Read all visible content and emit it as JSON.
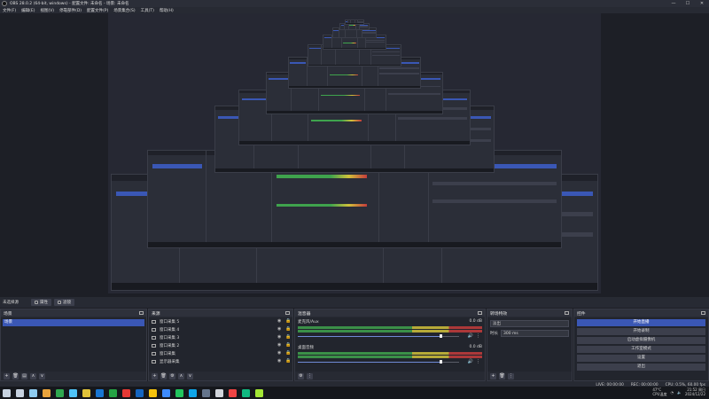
{
  "window": {
    "title": "OBS 28.0.2 (64-bit, windows) - 配置文件: 未命名 - 场景: 未命名",
    "min": "—",
    "max": "☐",
    "close": "✕"
  },
  "menu": [
    "文件(F)",
    "编辑(E)",
    "视图(V)",
    "停靠部件(D)",
    "配置文件(P)",
    "场景集合(S)",
    "工具(T)",
    "帮助(H)"
  ],
  "modebar": {
    "label": "未选择源",
    "properties": "属性",
    "filters": "滤镜"
  },
  "docks": {
    "scenes": {
      "title": "场景",
      "items": [
        "场景"
      ]
    },
    "sources": {
      "title": "来源",
      "items": [
        "窗口采集 5",
        "窗口采集 4",
        "窗口采集 3",
        "窗口采集 2",
        "窗口采集",
        "显示器采集"
      ]
    },
    "mixer": {
      "title": "混音器",
      "channels": [
        {
          "name": "麦克风/Aux",
          "db": "0.0 dB"
        },
        {
          "name": "桌面音频",
          "db": "0.0 dB"
        }
      ]
    },
    "transitions": {
      "title": "转场特效",
      "type_value": "淡出",
      "duration_label": "时长",
      "duration_value": "300 ms"
    },
    "controls": {
      "title": "控件",
      "buttons": [
        "开始直播",
        "开始录制",
        "启动虚拟摄像机",
        "工作室模式",
        "设置",
        "退出"
      ]
    }
  },
  "statusbar": {
    "live": "LIVE: 00:00:00",
    "rec": "REC: 00:00:00",
    "cpu": "CPU: 0.5%, 60.00 fps"
  },
  "taskbar": {
    "temp": "47°C",
    "temp_label": "CPU温度",
    "time": "21:52 周日",
    "date": "2024/12/22",
    "app_colors": [
      "#8ecbf0",
      "#e8a33c",
      "#2fa84f",
      "#4fc3f7",
      "#e0c23a",
      "#1976d2",
      "#25a244",
      "#e53935",
      "#1565c0",
      "#f4c20d",
      "#3d8bfd",
      "#22c55e",
      "#0ea5e9",
      "#64748b",
      "#d1d5db",
      "#ef4444",
      "#10b981",
      "#a3e635"
    ]
  }
}
